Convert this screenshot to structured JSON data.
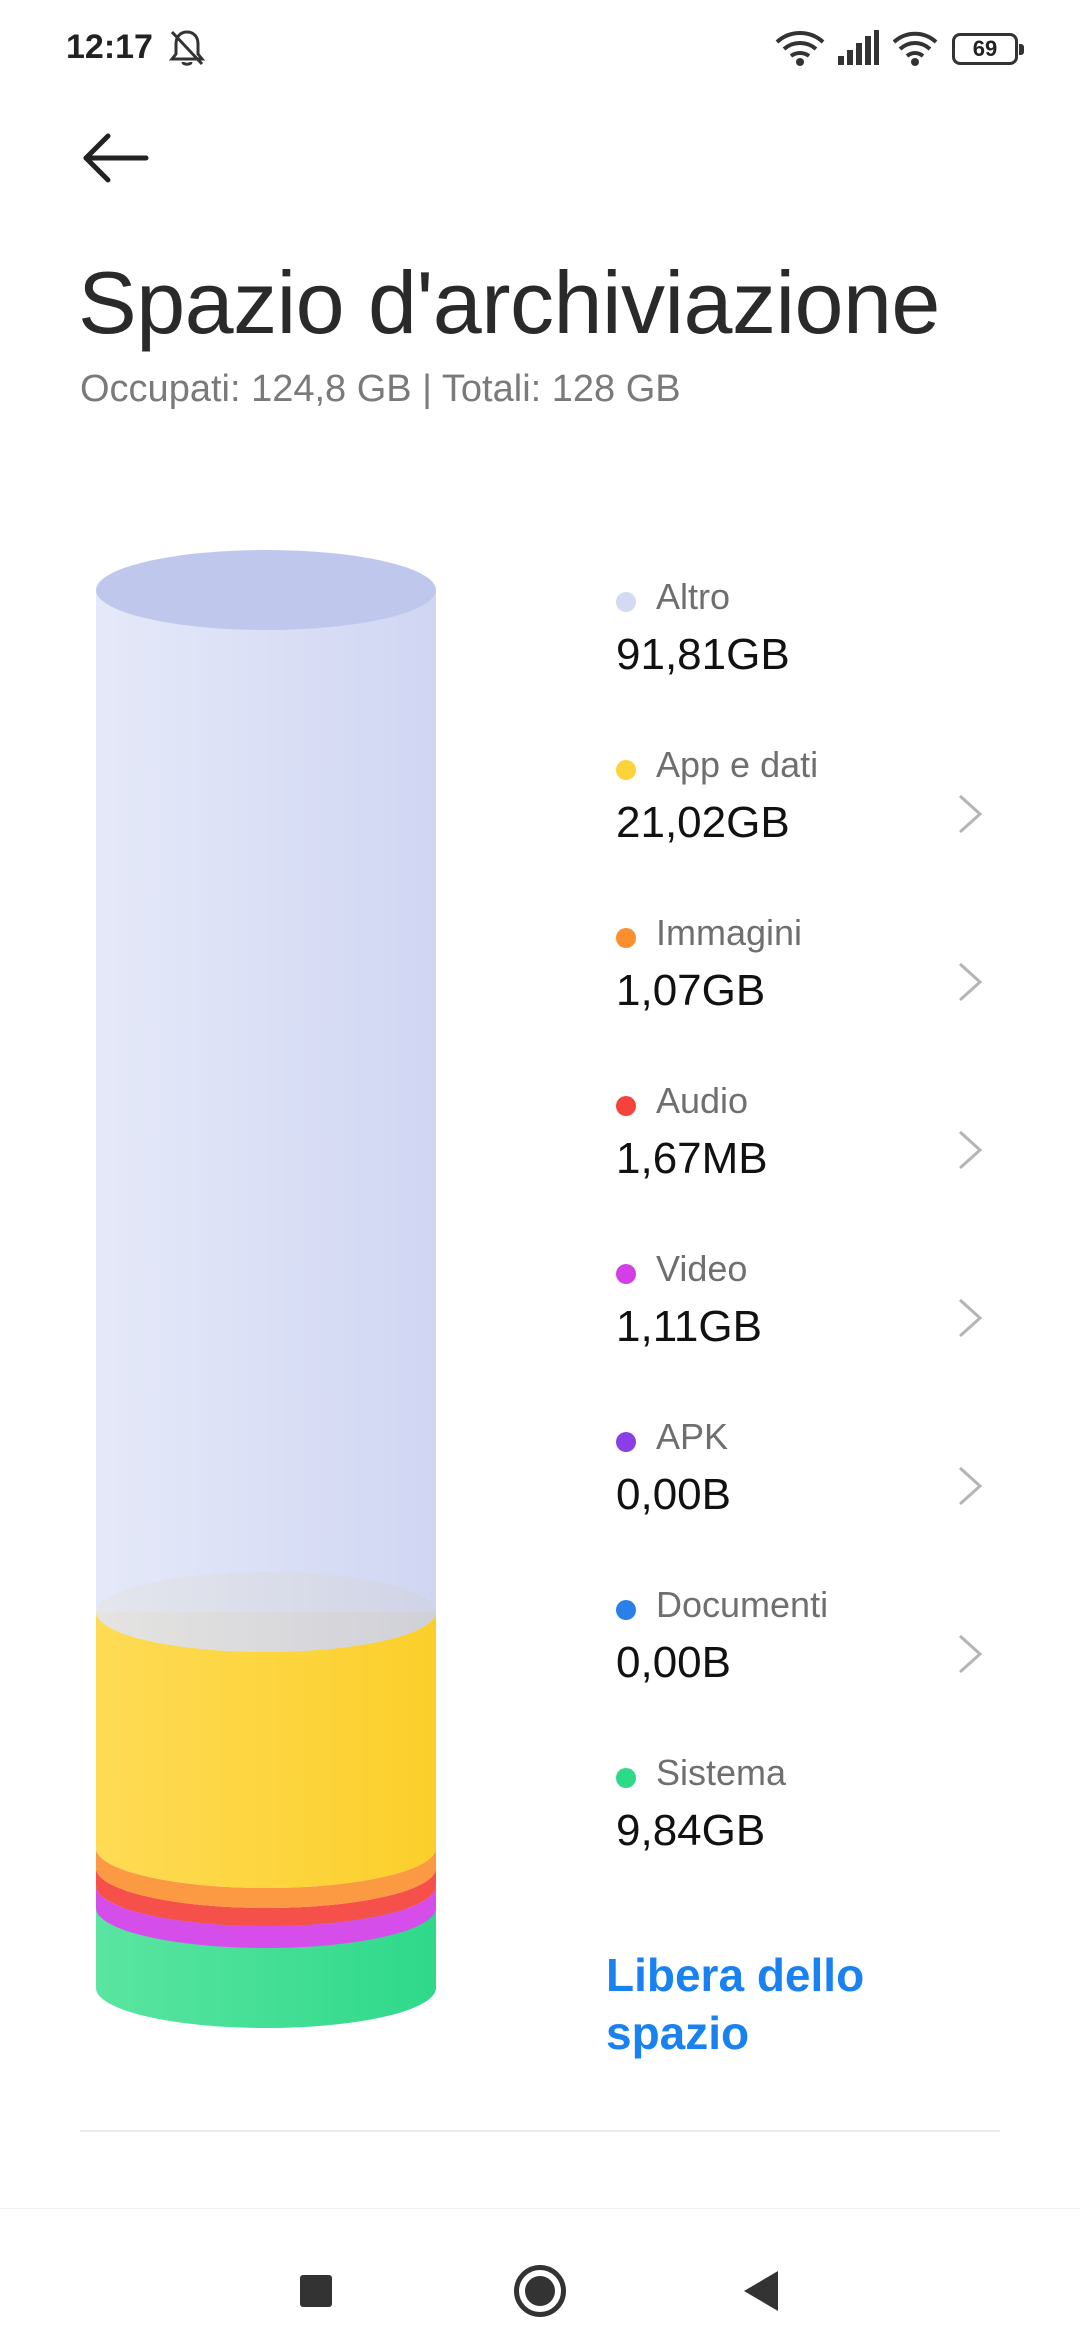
{
  "status_bar": {
    "time": "12:17",
    "battery": "69",
    "icons": [
      "bell-off-icon",
      "wifi-icon",
      "signal-icon",
      "wifi-icon",
      "battery-icon"
    ]
  },
  "header": {
    "back_icon": "arrow-left-icon",
    "title": "Spazio d'archiviazione",
    "subtitle": "Occupati: 124,8 GB | Totali: 128 GB"
  },
  "legend": [
    {
      "label": "Altro",
      "value": "91,81GB",
      "color": "#d4daf2",
      "chevron": false
    },
    {
      "label": "App e dati",
      "value": "21,02GB",
      "color": "#fdd33c",
      "chevron": true
    },
    {
      "label": "Immagini",
      "value": "1,07GB",
      "color": "#fb8f2d",
      "chevron": true
    },
    {
      "label": "Audio",
      "value": "1,67MB",
      "color": "#f6423c",
      "chevron": true
    },
    {
      "label": "Video",
      "value": "1,11GB",
      "color": "#d43ee6",
      "chevron": true
    },
    {
      "label": "APK",
      "value": "0,00B",
      "color": "#8a3fe6",
      "chevron": true
    },
    {
      "label": "Documenti",
      "value": "0,00B",
      "color": "#2a7fe8",
      "chevron": true
    },
    {
      "label": "Sistema",
      "value": "9,84GB",
      "color": "#2fd98a",
      "chevron": false
    }
  ],
  "action": {
    "free_space": "Libera dello spazio"
  },
  "nav_bar": {
    "icons": [
      "recents-square-icon",
      "home-circle-icon",
      "back-triangle-icon"
    ]
  }
}
